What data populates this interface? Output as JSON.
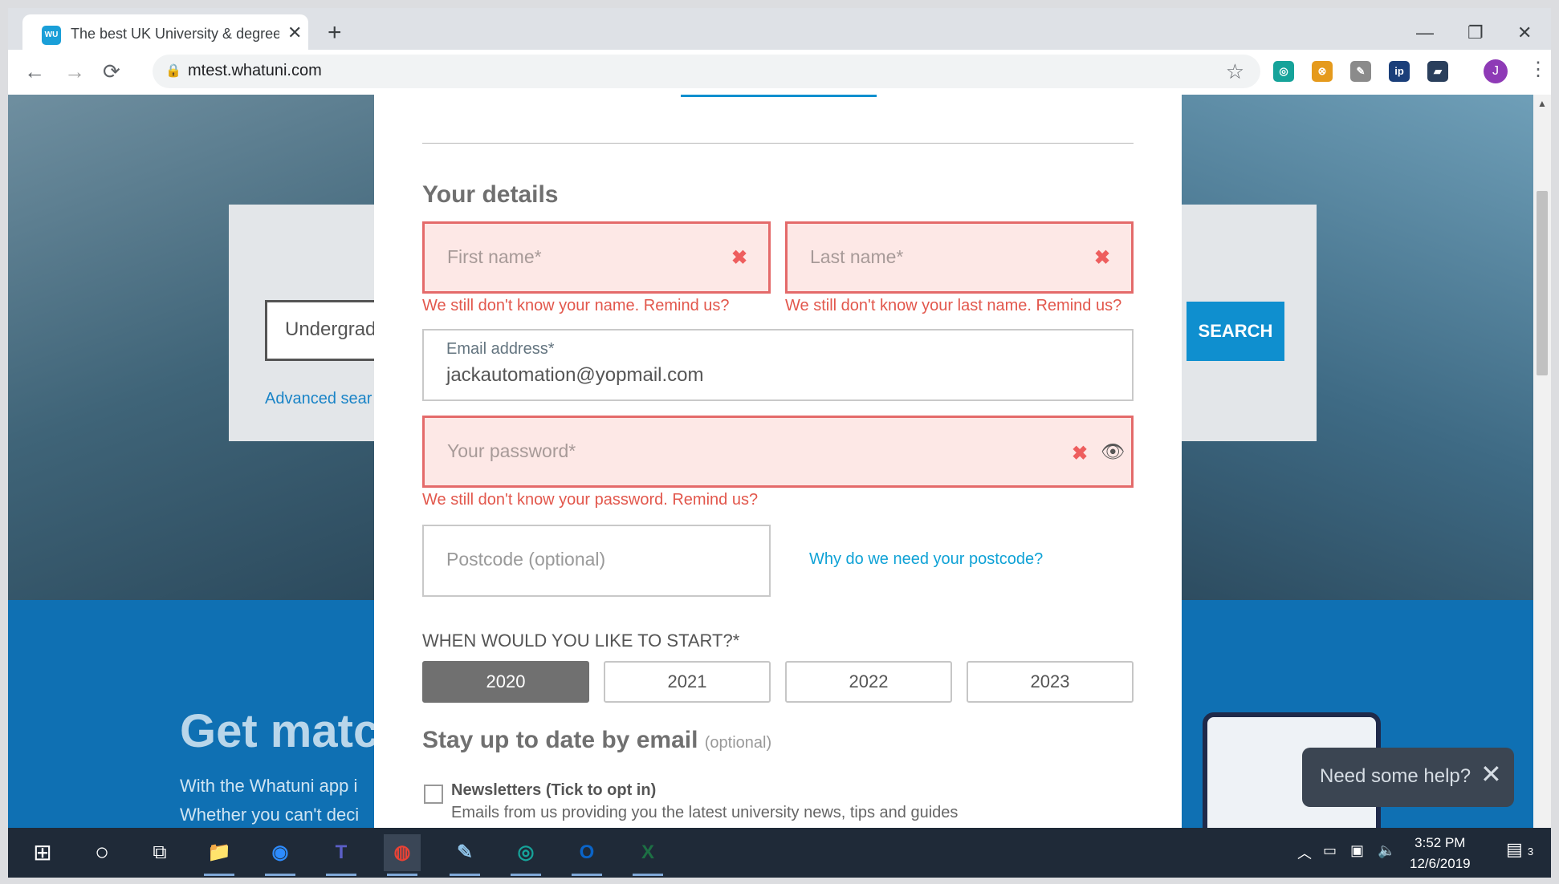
{
  "browser": {
    "tab_title": "The best UK University & degree",
    "favicon_text": "WU",
    "close_glyph": "✕",
    "new_tab_glyph": "+",
    "window": {
      "minimize": "—",
      "restore": "❐",
      "close": "✕"
    },
    "nav": {
      "back": "←",
      "forward": "→",
      "reload": "⟳"
    },
    "url": "mtest.whatuni.com",
    "lock_icon": "🔒",
    "star_icon": "☆",
    "profile_initial": "J",
    "kebab": "⋮",
    "extensions": [
      {
        "name": "ext-a-icon",
        "glyph": "◎",
        "color": "#16a39a"
      },
      {
        "name": "ext-b-icon",
        "glyph": "⊗",
        "color": "#e59a1c"
      },
      {
        "name": "ext-c-icon",
        "glyph": "✎",
        "color": "#8b8b8b"
      },
      {
        "name": "ext-ip-icon",
        "glyph": "ip",
        "color": "#1b3f7a"
      },
      {
        "name": "ext-d-icon",
        "glyph": "▰",
        "color": "#2a3f5c"
      }
    ]
  },
  "page": {
    "search_input_text": "Undergrad",
    "search_button": "SEARCH",
    "advanced_search": "Advanced sear",
    "get_matched": "Get matc",
    "app_line1": "With the Whatuni app i",
    "app_line2": "Whether you can't deci",
    "help_text": "Need some help?",
    "help_close": "✕",
    "scroll_up": "▲"
  },
  "modal": {
    "details_heading": "Your details",
    "first_name_placeholder": "First name*",
    "first_name_error": "We still don't know your name. Remind us?",
    "last_name_placeholder": "Last name*",
    "last_name_error": "We still don't know your last name. Remind us?",
    "email_label": "Email address*",
    "email_value": "jackautomation@yopmail.com",
    "password_placeholder": "Your password*",
    "password_error": "We still don't know your password. Remind us?",
    "error_icon": "✖",
    "eye_icon": "👁",
    "postcode_placeholder": "Postcode (optional)",
    "postcode_why": "Why do we need your postcode?",
    "start_heading": "WHEN WOULD YOU LIKE TO START?*",
    "years": [
      "2020",
      "2021",
      "2022",
      "2023"
    ],
    "selected_year": "2020",
    "email_heading": "Stay up to date by email",
    "email_heading_optional": "(optional)",
    "newsletter_title": "Newsletters (Tick to opt in)",
    "newsletter_desc": "Emails from us providing you the latest university news, tips and guides"
  },
  "taskbar": {
    "start_icon": "⊞",
    "search_icon": "○",
    "taskview_icon": "⧉",
    "apps": [
      {
        "name": "file-explorer-icon",
        "glyph": "📁",
        "color": "#f2c33b",
        "active": false
      },
      {
        "name": "zoom-icon",
        "glyph": "◉",
        "color": "#2d8cff",
        "active": false
      },
      {
        "name": "teams-icon",
        "glyph": "T",
        "color": "#5b5fc7",
        "active": false
      },
      {
        "name": "chrome-icon",
        "glyph": "◍",
        "color": "#e94235",
        "active": true
      },
      {
        "name": "notepad-icon",
        "glyph": "✎",
        "color": "#8fc3e8",
        "active": false
      },
      {
        "name": "app-icon",
        "glyph": "◎",
        "color": "#16a39a",
        "active": false
      },
      {
        "name": "outlook-icon",
        "glyph": "O",
        "color": "#0a64c8",
        "active": false
      },
      {
        "name": "excel-icon",
        "glyph": "X",
        "color": "#1d7044",
        "active": false
      }
    ],
    "tray_chevron": "︿",
    "tray_battery": "▭",
    "tray_network": "▣",
    "tray_volume": "🔈",
    "time": "3:52 PM",
    "date": "12/6/2019",
    "notification_icon": "▤",
    "notification_count": "3"
  }
}
